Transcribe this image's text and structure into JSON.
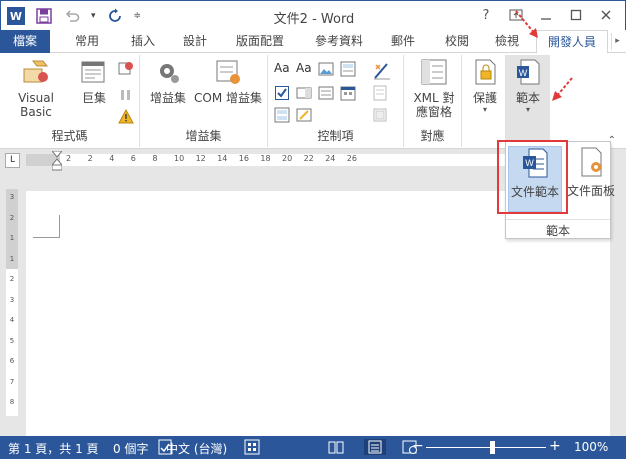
{
  "window": {
    "title": "文件2 - Word",
    "help_label": "?",
    "controls": [
      "ribbon-display-options",
      "minimize",
      "restore",
      "close"
    ]
  },
  "qat": {
    "app_icon_letter": "W",
    "icons": [
      "save-icon",
      "undo-icon",
      "redo-icon",
      "customize-qat-icon"
    ]
  },
  "tabs": [
    {
      "label": "檔案",
      "active": false
    },
    {
      "label": "常用",
      "active": false
    },
    {
      "label": "插入",
      "active": false
    },
    {
      "label": "設計",
      "active": false
    },
    {
      "label": "版面配置",
      "active": false
    },
    {
      "label": "參考資料",
      "active": false
    },
    {
      "label": "郵件",
      "active": false
    },
    {
      "label": "校閱",
      "active": false
    },
    {
      "label": "檢視",
      "active": false
    },
    {
      "label": "開發人員",
      "active": true
    }
  ],
  "ribbon": {
    "groups": [
      {
        "label": "程式碼",
        "buttons": [
          "Visual Basic",
          "巨集"
        ]
      },
      {
        "label": "增益集",
        "buttons": [
          "增益集",
          "COM 增益集"
        ]
      },
      {
        "label": "控制項",
        "buttons": []
      },
      {
        "label": "對應",
        "buttons": [
          "XML 對應窗格"
        ]
      },
      {
        "label": "",
        "buttons": [
          "保護"
        ]
      },
      {
        "label": "",
        "buttons": [
          "範本"
        ]
      }
    ],
    "protect_label": "保護",
    "template_label": "範本",
    "xml_label_line1": "XML 對",
    "xml_label_line2": "應窗格",
    "font_aa_1": "Aa",
    "font_aa_2": "Aa"
  },
  "ruler": {
    "tab_stop_symbol": "L",
    "h_numbers": [
      "2",
      "2",
      "4",
      "6",
      "8",
      "10",
      "12",
      "14",
      "16",
      "18",
      "20",
      "22",
      "24",
      "26"
    ],
    "v_numbers": [
      "3",
      "2",
      "1",
      "1",
      "2",
      "3",
      "4",
      "5",
      "6",
      "7",
      "8"
    ]
  },
  "dropdown": {
    "items": [
      {
        "label": "文件範本",
        "selected": true
      },
      {
        "label": "文件面板",
        "selected": false
      }
    ],
    "group_label": "範本"
  },
  "statusbar": {
    "page_info": "第 1 頁，共 1 頁",
    "word_count": "0 個字",
    "language": "中文 (台灣)",
    "zoom_minus": "−",
    "zoom_plus": "+",
    "zoom_level": "100%",
    "zoom_fraction": 0.55
  },
  "colors": {
    "accent": "#2b579a",
    "selection": "#c5d9f1",
    "highlight_frame": "#e03a3a"
  }
}
